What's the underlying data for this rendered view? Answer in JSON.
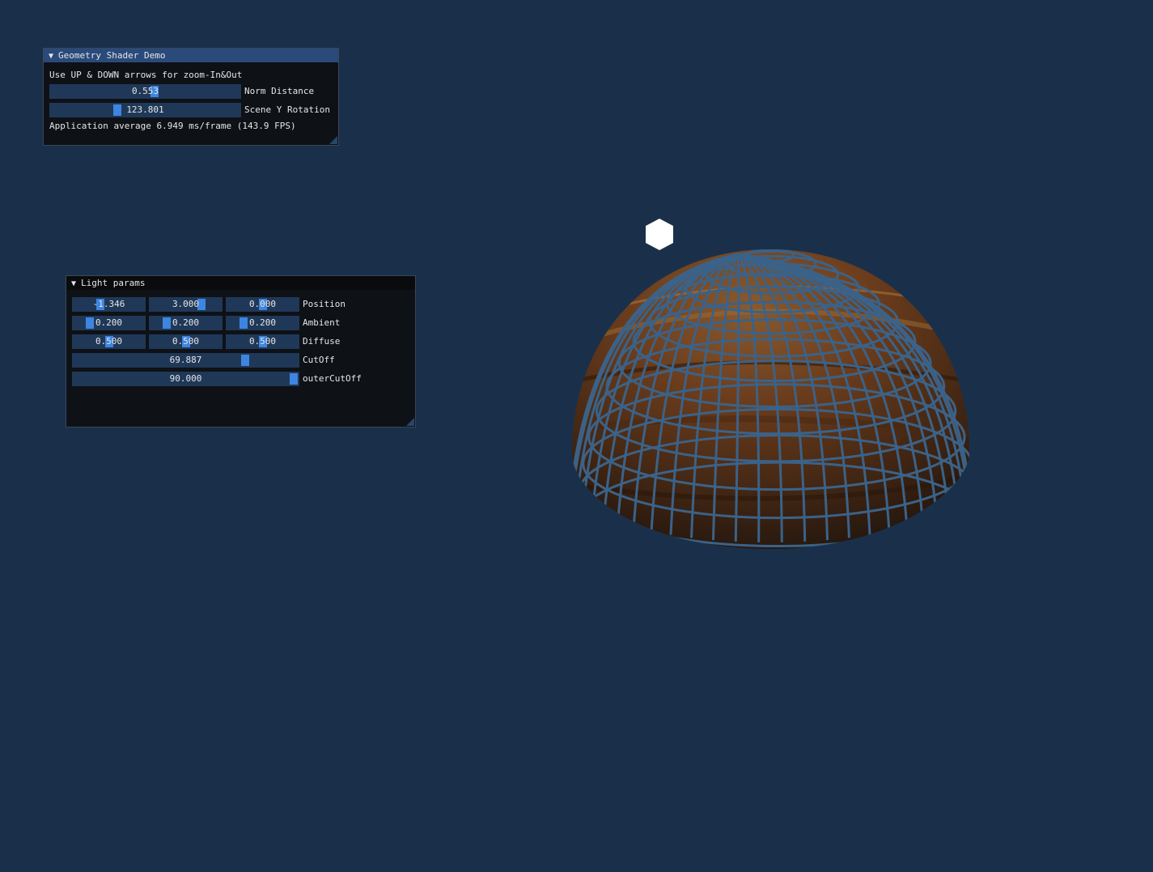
{
  "geometry_window": {
    "title": "Geometry Shader Demo",
    "instructions": "Use UP & DOWN arrows for zoom-In&Out",
    "sliders": [
      {
        "label": "Norm Distance",
        "value": "0.553",
        "fraction": 0.553
      },
      {
        "label": "Scene Y Rotation",
        "value": "123.801",
        "fraction": 0.344
      }
    ],
    "stats": "Application average 6.949 ms/frame (143.9 FPS)"
  },
  "light_window": {
    "title": "Light params",
    "rows": [
      {
        "label": "Position",
        "values": [
          "-1.346",
          "3.000",
          "0.000"
        ],
        "fractions": [
          0.366,
          0.75,
          0.5
        ]
      },
      {
        "label": "Ambient",
        "values": [
          "0.200",
          "0.200",
          "0.200"
        ],
        "fractions": [
          0.2,
          0.2,
          0.2
        ]
      },
      {
        "label": "Diffuse",
        "values": [
          "0.500",
          "0.500",
          "0.500"
        ],
        "fractions": [
          0.5,
          0.5,
          0.5
        ]
      }
    ],
    "single_rows": [
      {
        "label": "CutOff",
        "value": "69.887",
        "fraction": 0.776
      },
      {
        "label": "outerCutOff",
        "value": "90.000",
        "fraction": 1.0
      }
    ]
  },
  "colors": {
    "background": "#1a304a",
    "slider_grab": "#3d85e0",
    "slider_bg": "#203858",
    "title_active": "#294a7a",
    "wireframe": "#3b6288",
    "dome_wood": "#5a3218",
    "light_cube": "#ffffff"
  }
}
